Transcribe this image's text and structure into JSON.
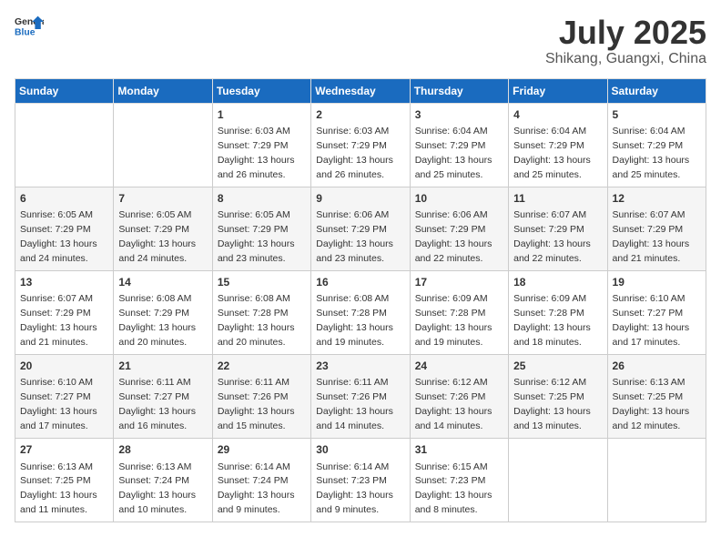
{
  "header": {
    "logo_general": "General",
    "logo_blue": "Blue",
    "month_year": "July 2025",
    "location": "Shikang, Guangxi, China"
  },
  "days_of_week": [
    "Sunday",
    "Monday",
    "Tuesday",
    "Wednesday",
    "Thursday",
    "Friday",
    "Saturday"
  ],
  "weeks": [
    [
      {
        "day": "",
        "detail": ""
      },
      {
        "day": "",
        "detail": ""
      },
      {
        "day": "1",
        "detail": "Sunrise: 6:03 AM\nSunset: 7:29 PM\nDaylight: 13 hours and 26 minutes."
      },
      {
        "day": "2",
        "detail": "Sunrise: 6:03 AM\nSunset: 7:29 PM\nDaylight: 13 hours and 26 minutes."
      },
      {
        "day": "3",
        "detail": "Sunrise: 6:04 AM\nSunset: 7:29 PM\nDaylight: 13 hours and 25 minutes."
      },
      {
        "day": "4",
        "detail": "Sunrise: 6:04 AM\nSunset: 7:29 PM\nDaylight: 13 hours and 25 minutes."
      },
      {
        "day": "5",
        "detail": "Sunrise: 6:04 AM\nSunset: 7:29 PM\nDaylight: 13 hours and 25 minutes."
      }
    ],
    [
      {
        "day": "6",
        "detail": "Sunrise: 6:05 AM\nSunset: 7:29 PM\nDaylight: 13 hours and 24 minutes."
      },
      {
        "day": "7",
        "detail": "Sunrise: 6:05 AM\nSunset: 7:29 PM\nDaylight: 13 hours and 24 minutes."
      },
      {
        "day": "8",
        "detail": "Sunrise: 6:05 AM\nSunset: 7:29 PM\nDaylight: 13 hours and 23 minutes."
      },
      {
        "day": "9",
        "detail": "Sunrise: 6:06 AM\nSunset: 7:29 PM\nDaylight: 13 hours and 23 minutes."
      },
      {
        "day": "10",
        "detail": "Sunrise: 6:06 AM\nSunset: 7:29 PM\nDaylight: 13 hours and 22 minutes."
      },
      {
        "day": "11",
        "detail": "Sunrise: 6:07 AM\nSunset: 7:29 PM\nDaylight: 13 hours and 22 minutes."
      },
      {
        "day": "12",
        "detail": "Sunrise: 6:07 AM\nSunset: 7:29 PM\nDaylight: 13 hours and 21 minutes."
      }
    ],
    [
      {
        "day": "13",
        "detail": "Sunrise: 6:07 AM\nSunset: 7:29 PM\nDaylight: 13 hours and 21 minutes."
      },
      {
        "day": "14",
        "detail": "Sunrise: 6:08 AM\nSunset: 7:29 PM\nDaylight: 13 hours and 20 minutes."
      },
      {
        "day": "15",
        "detail": "Sunrise: 6:08 AM\nSunset: 7:28 PM\nDaylight: 13 hours and 20 minutes."
      },
      {
        "day": "16",
        "detail": "Sunrise: 6:08 AM\nSunset: 7:28 PM\nDaylight: 13 hours and 19 minutes."
      },
      {
        "day": "17",
        "detail": "Sunrise: 6:09 AM\nSunset: 7:28 PM\nDaylight: 13 hours and 19 minutes."
      },
      {
        "day": "18",
        "detail": "Sunrise: 6:09 AM\nSunset: 7:28 PM\nDaylight: 13 hours and 18 minutes."
      },
      {
        "day": "19",
        "detail": "Sunrise: 6:10 AM\nSunset: 7:27 PM\nDaylight: 13 hours and 17 minutes."
      }
    ],
    [
      {
        "day": "20",
        "detail": "Sunrise: 6:10 AM\nSunset: 7:27 PM\nDaylight: 13 hours and 17 minutes."
      },
      {
        "day": "21",
        "detail": "Sunrise: 6:11 AM\nSunset: 7:27 PM\nDaylight: 13 hours and 16 minutes."
      },
      {
        "day": "22",
        "detail": "Sunrise: 6:11 AM\nSunset: 7:26 PM\nDaylight: 13 hours and 15 minutes."
      },
      {
        "day": "23",
        "detail": "Sunrise: 6:11 AM\nSunset: 7:26 PM\nDaylight: 13 hours and 14 minutes."
      },
      {
        "day": "24",
        "detail": "Sunrise: 6:12 AM\nSunset: 7:26 PM\nDaylight: 13 hours and 14 minutes."
      },
      {
        "day": "25",
        "detail": "Sunrise: 6:12 AM\nSunset: 7:25 PM\nDaylight: 13 hours and 13 minutes."
      },
      {
        "day": "26",
        "detail": "Sunrise: 6:13 AM\nSunset: 7:25 PM\nDaylight: 13 hours and 12 minutes."
      }
    ],
    [
      {
        "day": "27",
        "detail": "Sunrise: 6:13 AM\nSunset: 7:25 PM\nDaylight: 13 hours and 11 minutes."
      },
      {
        "day": "28",
        "detail": "Sunrise: 6:13 AM\nSunset: 7:24 PM\nDaylight: 13 hours and 10 minutes."
      },
      {
        "day": "29",
        "detail": "Sunrise: 6:14 AM\nSunset: 7:24 PM\nDaylight: 13 hours and 9 minutes."
      },
      {
        "day": "30",
        "detail": "Sunrise: 6:14 AM\nSunset: 7:23 PM\nDaylight: 13 hours and 9 minutes."
      },
      {
        "day": "31",
        "detail": "Sunrise: 6:15 AM\nSunset: 7:23 PM\nDaylight: 13 hours and 8 minutes."
      },
      {
        "day": "",
        "detail": ""
      },
      {
        "day": "",
        "detail": ""
      }
    ]
  ]
}
